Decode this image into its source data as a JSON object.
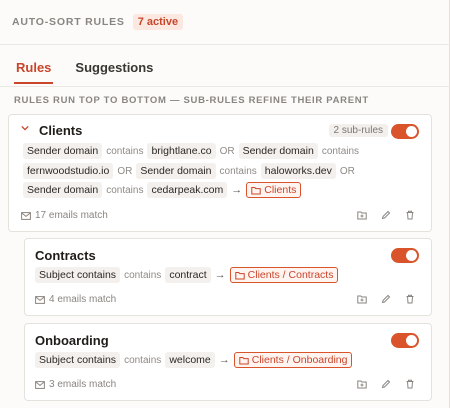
{
  "header": {
    "title": "AUTO-SORT RULES",
    "active_count": "7 active"
  },
  "tabs": [
    {
      "label": "Rules"
    },
    {
      "label": "Suggestions"
    }
  ],
  "hint": "RULES RUN TOP TO BOTTOM — SUB-RULES REFINE THEIR PARENT",
  "rules": [
    {
      "name": "Clients",
      "sub_badge": "2 sub-rules",
      "enabled": true,
      "lines": [
        {
          "chips": [
            "Sender domain",
            "contains",
            "brightlane.co",
            "OR",
            "Sender domain",
            "contains"
          ]
        },
        {
          "chips": [
            "fernwoodstudio.io",
            "OR",
            "Sender domain",
            "contains",
            "haloworks.dev",
            "OR"
          ]
        },
        {
          "chips": [
            "Sender domain",
            "contains",
            "cedarpeak.com",
            "→",
            "Clients"
          ]
        }
      ],
      "match": "17 emails match"
    },
    {
      "name": "Contracts",
      "enabled": true,
      "field": "Subject contains",
      "op": "contains",
      "value": "contract",
      "arrow": "→",
      "folder": "Clients / Contracts",
      "match": "4 emails match"
    },
    {
      "name": "Onboarding",
      "enabled": true,
      "field": "Subject contains",
      "op": "contains",
      "value": "welcome",
      "arrow": "→",
      "folder": "Clients / Onboarding",
      "match": "3 emails match"
    }
  ],
  "colors": {
    "accent": "#d9532b",
    "accent_text": "#c9452b",
    "muted": "#8a8580"
  }
}
